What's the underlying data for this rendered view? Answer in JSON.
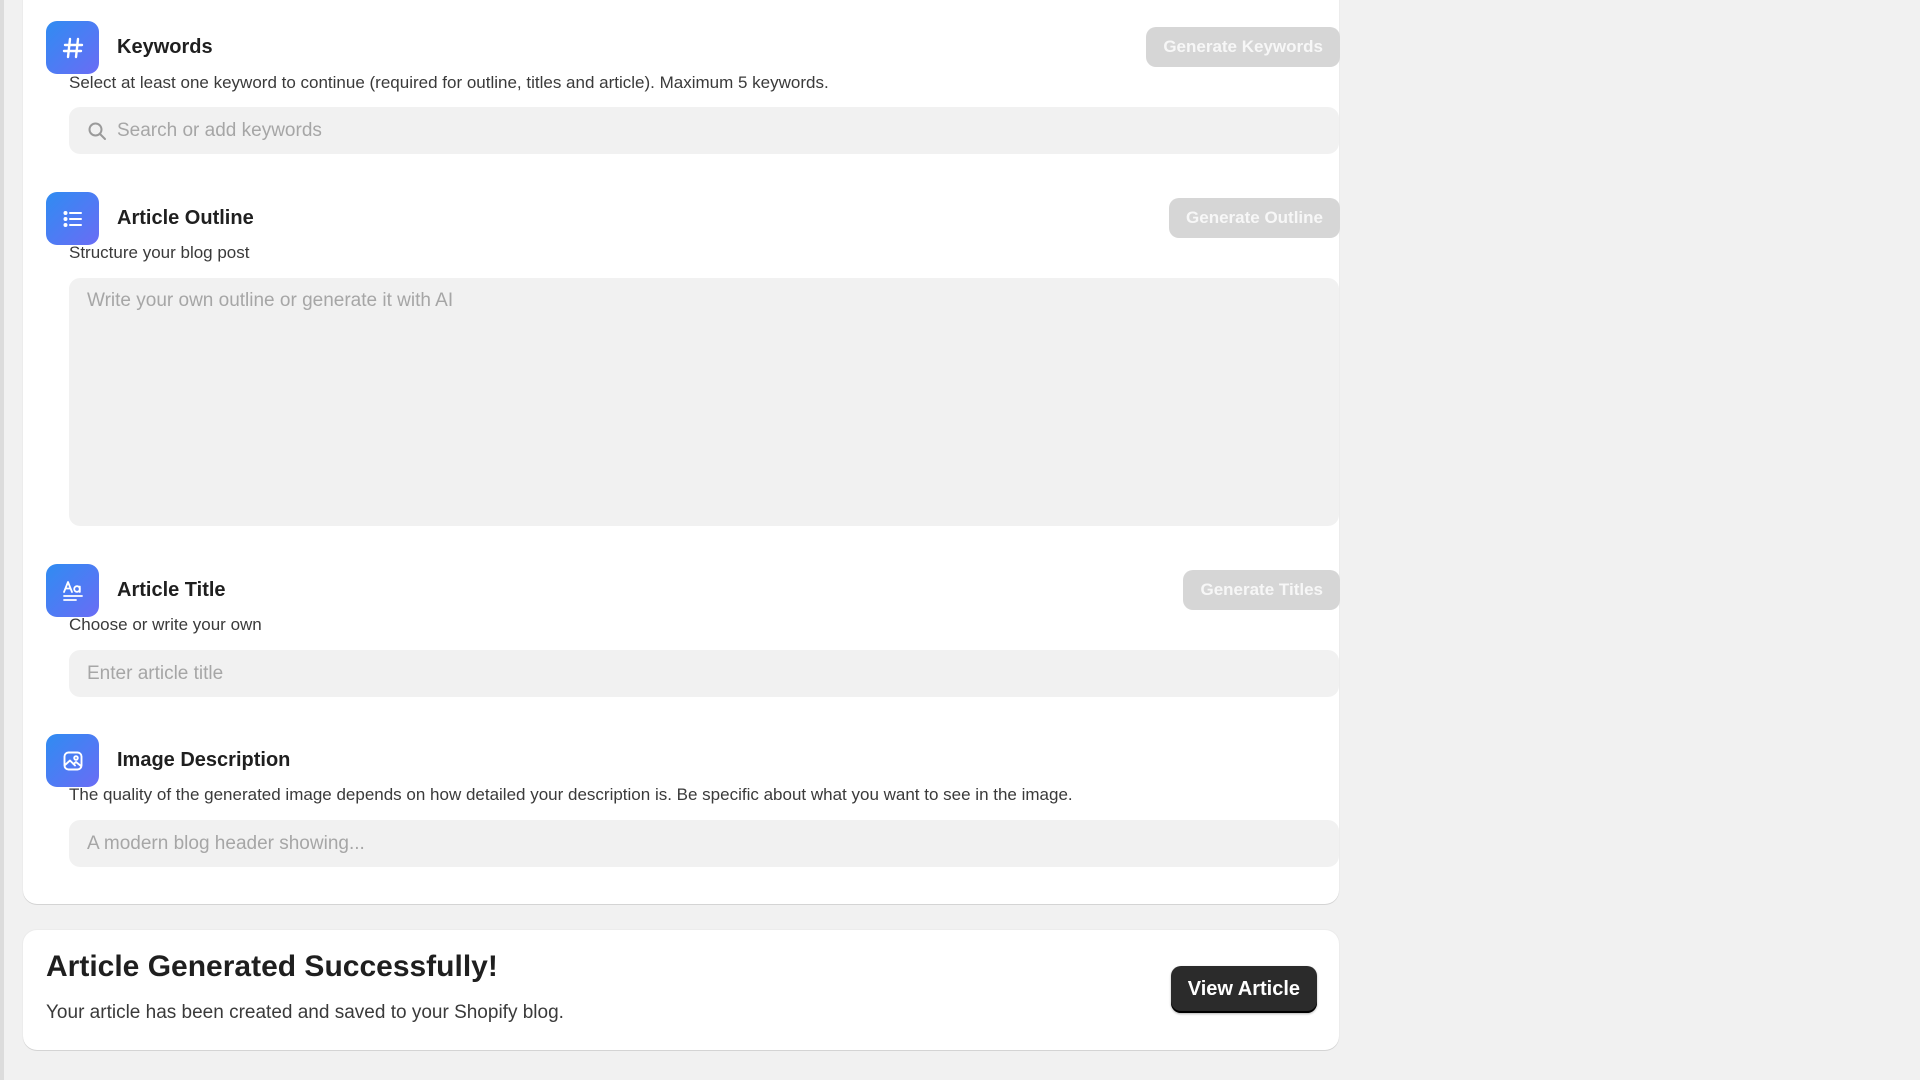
{
  "keywords": {
    "title": "Keywords",
    "icon": "hash-icon",
    "button": "Generate Keywords",
    "help": "Select at least one keyword to continue (required for outline, titles and article). Maximum 5 keywords.",
    "placeholder": "Search or add keywords",
    "value": ""
  },
  "outline": {
    "title": "Article Outline",
    "icon": "list-icon",
    "button": "Generate Outline",
    "help": "Structure your blog post",
    "placeholder": "Write your own outline or generate it with AI",
    "value": ""
  },
  "article_title": {
    "title": "Article Title",
    "icon": "text-format-icon",
    "button": "Generate Titles",
    "help": "Choose or write your own",
    "placeholder": "Enter article title",
    "value": ""
  },
  "image_description": {
    "title": "Image Description",
    "icon": "image-icon",
    "help": "The quality of the generated image depends on how detailed your description is. Be specific about what you want to see in the image.",
    "placeholder": "A modern blog header showing...",
    "value": ""
  },
  "success": {
    "title": "Article Generated Successfully!",
    "text": "Your article has been created and saved to your Shopify blog.",
    "button": "View Article"
  },
  "colors": {
    "icon_gradient_start": "#2f8cf2",
    "icon_gradient_end": "#6a6cf5",
    "disabled_button": "#d6d6d6",
    "primary_button": "#2b2b2b",
    "field_background": "#f1f1f1"
  }
}
